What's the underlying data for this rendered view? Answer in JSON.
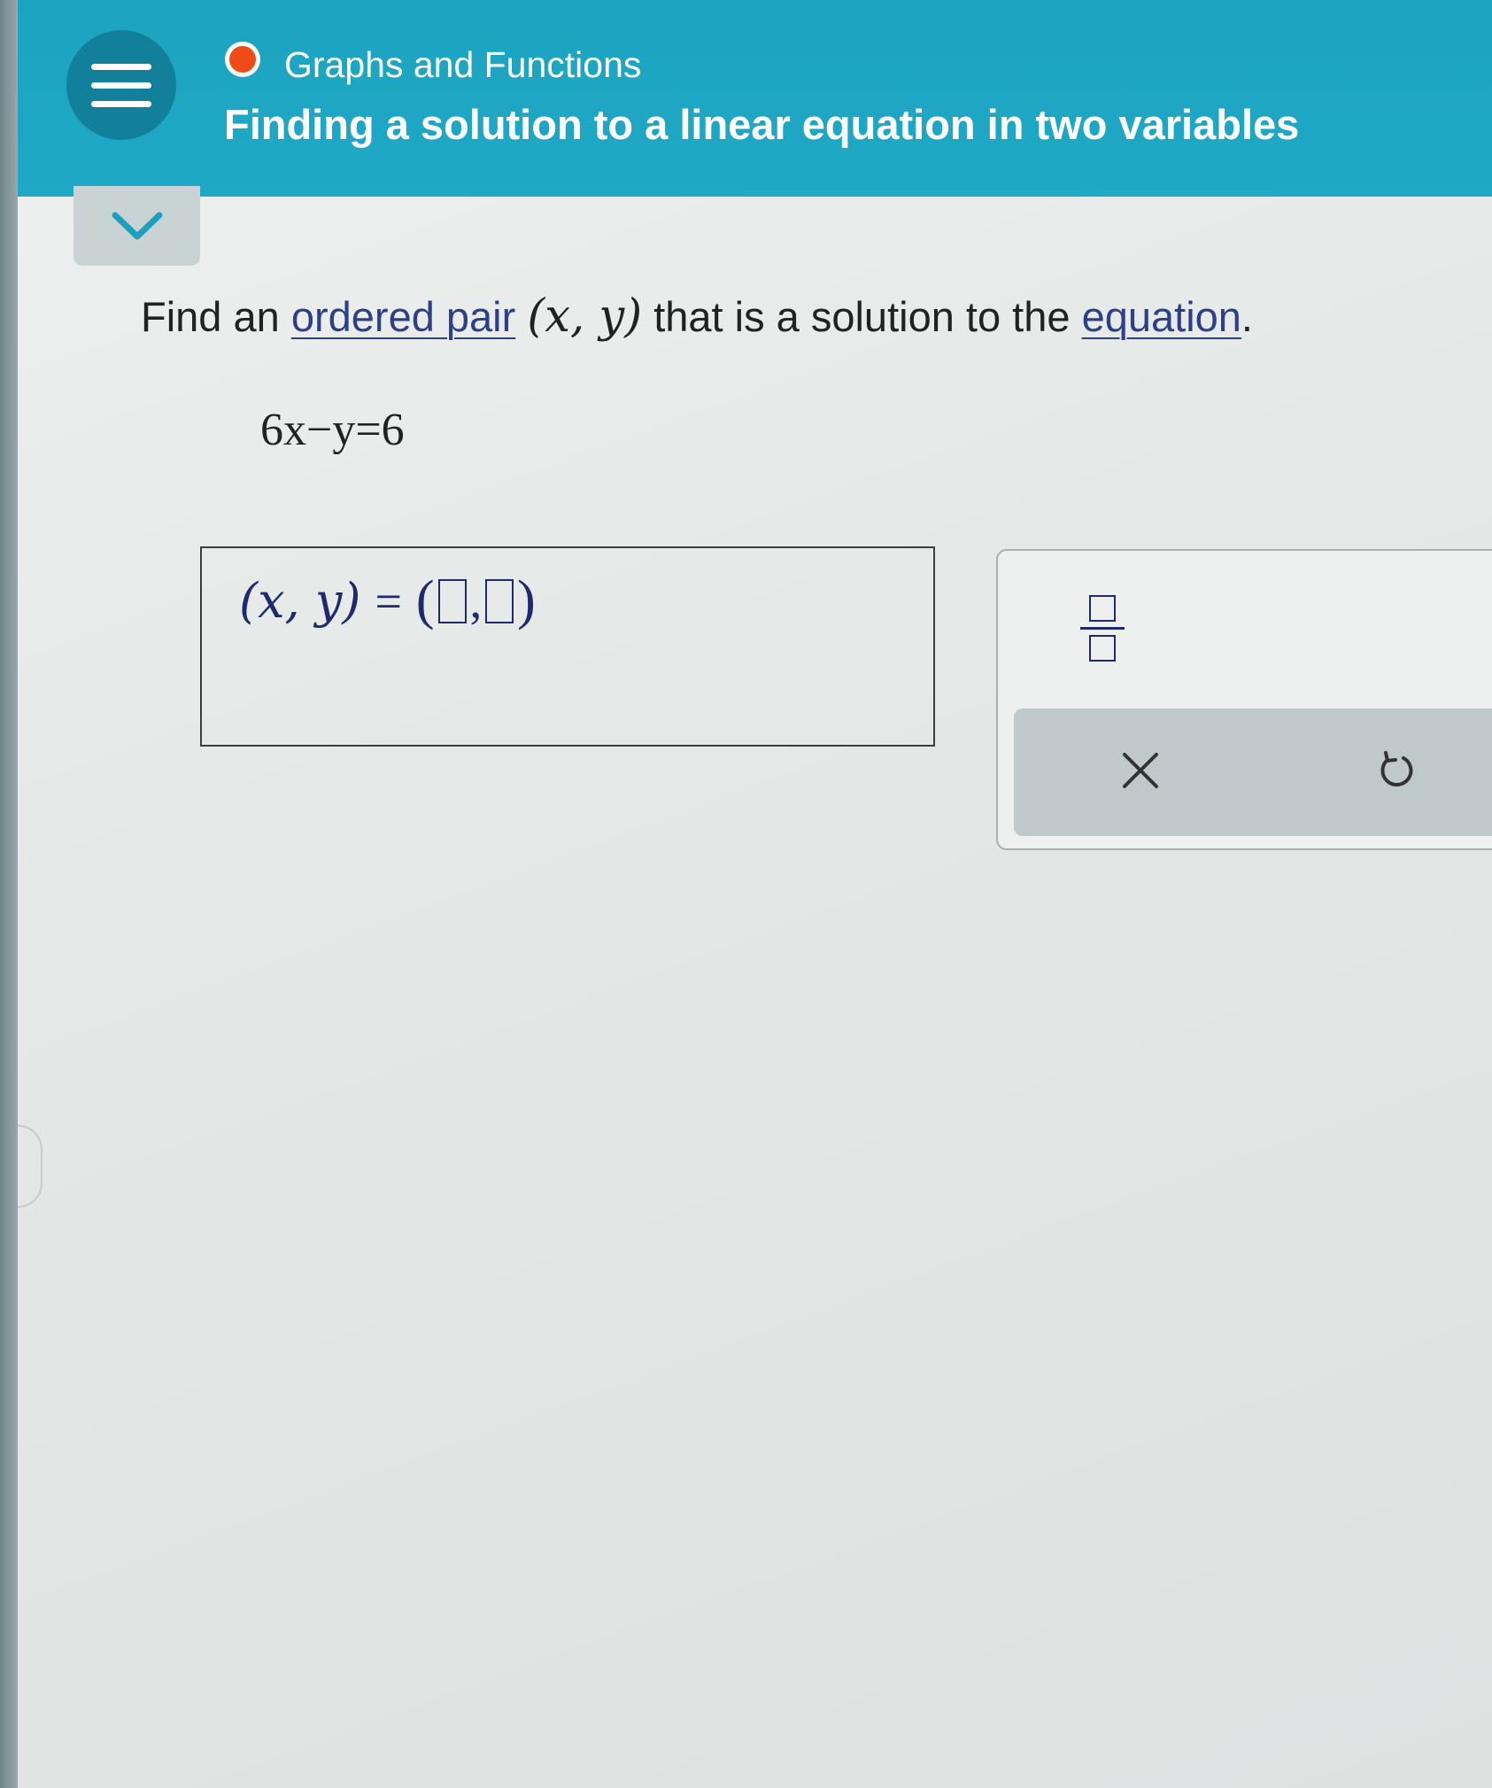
{
  "header": {
    "menu_icon": "hamburger-menu-icon",
    "topic_label": "Graphs and Functions",
    "topic_status_color": "#f04a16",
    "title": "Finding a solution to a linear equation in two variables",
    "accent_color": "#1fa9c6"
  },
  "collapse_icon": "chevron-down-icon",
  "question": {
    "prefix": "Find an",
    "link_ordered_pair": "ordered pair",
    "pair": "(x, y)",
    "middle": "that is a solution to the",
    "link_equation": "equation",
    "suffix": "."
  },
  "equation": "6x−y=6",
  "answer": {
    "lhs": "(x, y)",
    "equals": "=",
    "open_paren": "(",
    "comma": ",",
    "close_paren": ")",
    "x_value": "",
    "y_value": ""
  },
  "keypad": {
    "fraction_icon": "fraction-icon",
    "clear_icon": "close-icon",
    "undo_icon": "undo-icon"
  }
}
